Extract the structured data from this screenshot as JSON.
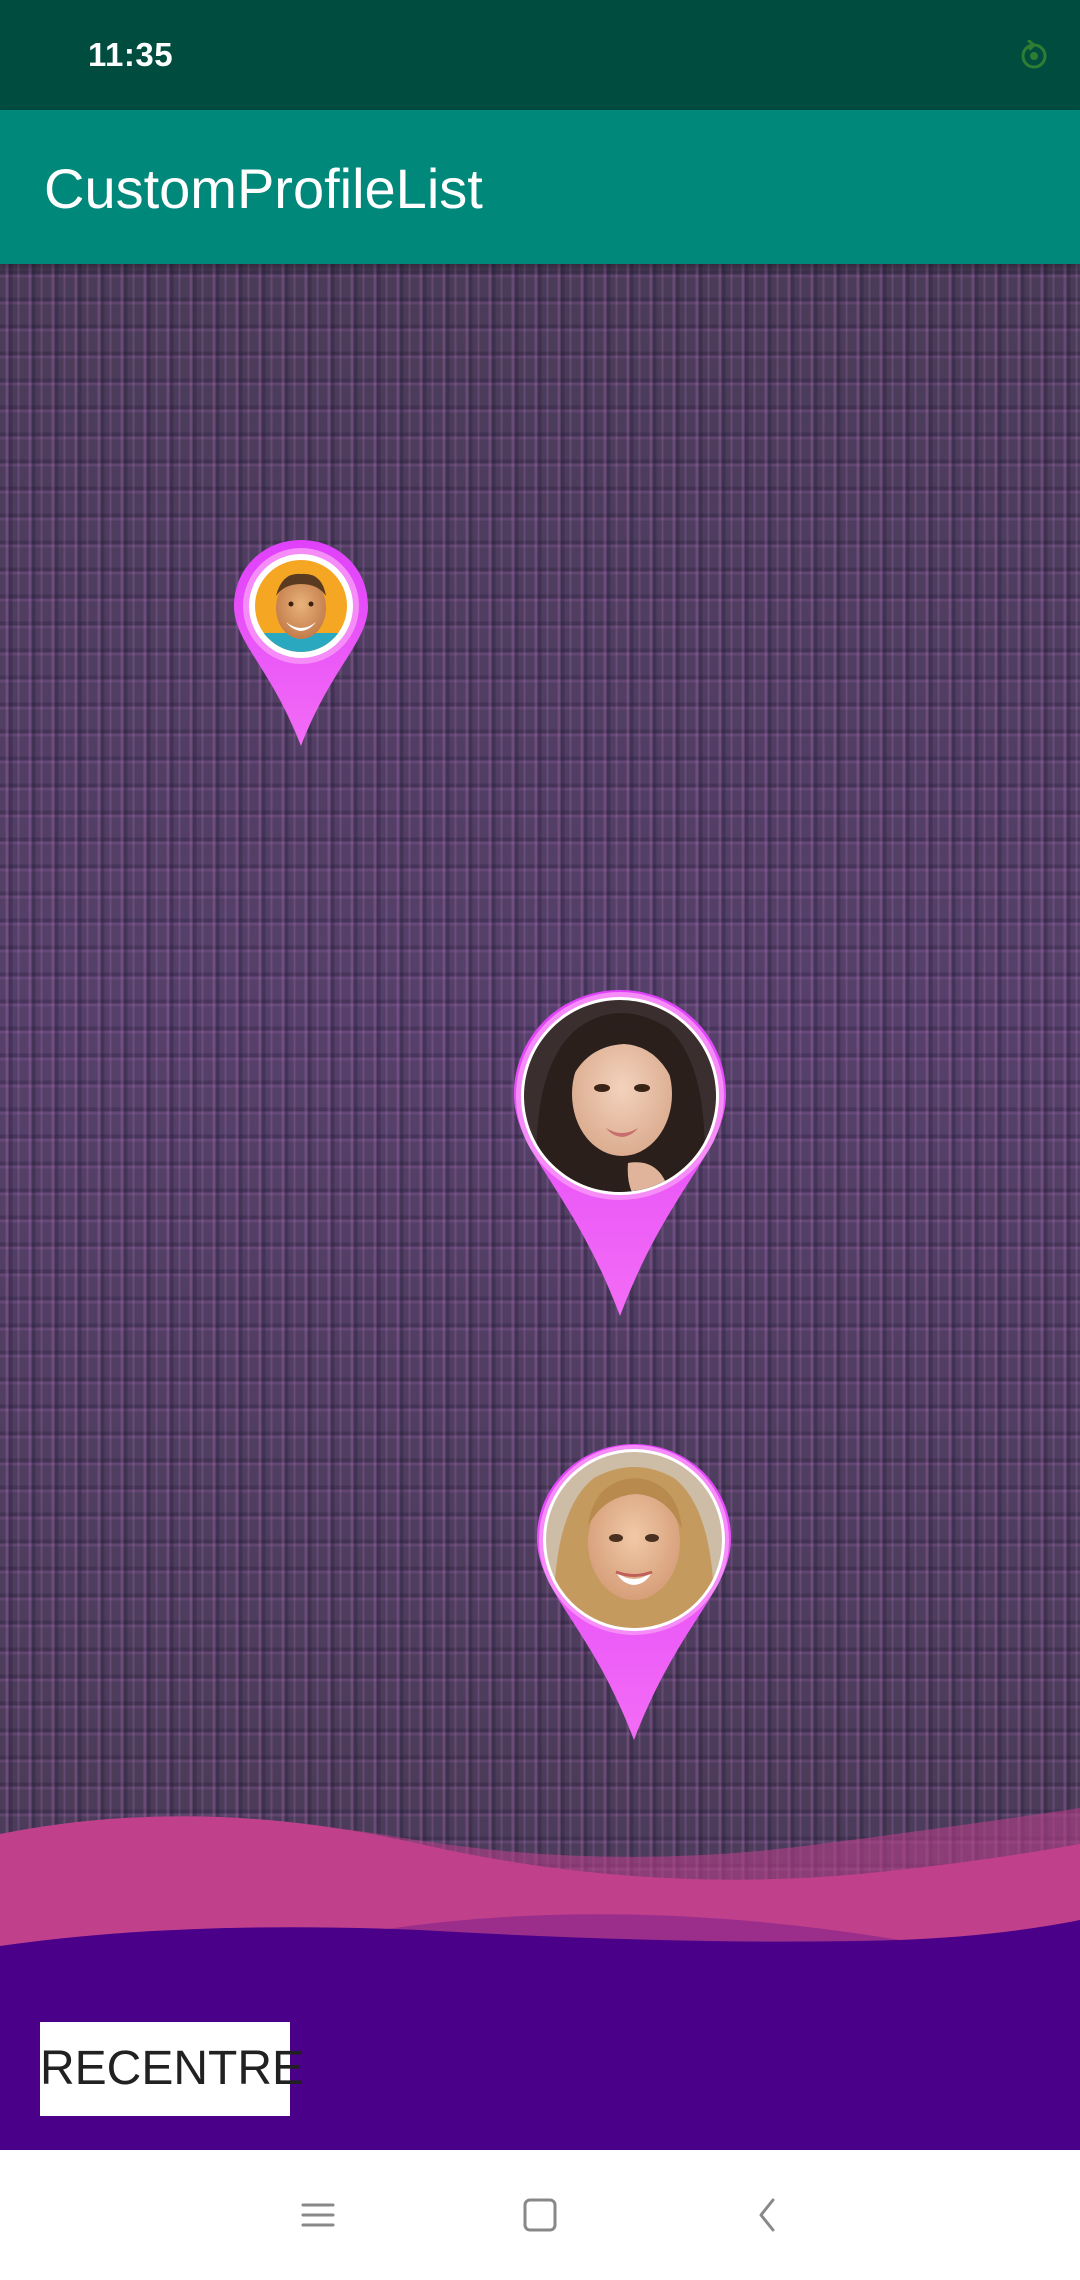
{
  "status_bar": {
    "time": "11:35",
    "sync_icon": "sync-icon",
    "sync_color": "#2e7d32"
  },
  "app_bar": {
    "title": "CustomProfileList",
    "color": "#00897b"
  },
  "map": {
    "markers": [
      {
        "name": "profile-marker-man",
        "avatar": "man-avatar"
      },
      {
        "name": "profile-marker-woman-1",
        "avatar": "woman-avatar"
      },
      {
        "name": "profile-marker-woman-2",
        "avatar": "woman-avatar"
      }
    ],
    "marker_color": "#e040fb"
  },
  "bottom": {
    "recentre_label": "RECENTRE",
    "wave_pink": "#c0408c",
    "deep_purple": "#4a0088"
  },
  "nav_bar": {
    "icons": [
      "menu-icon",
      "home-icon",
      "back-icon"
    ]
  }
}
